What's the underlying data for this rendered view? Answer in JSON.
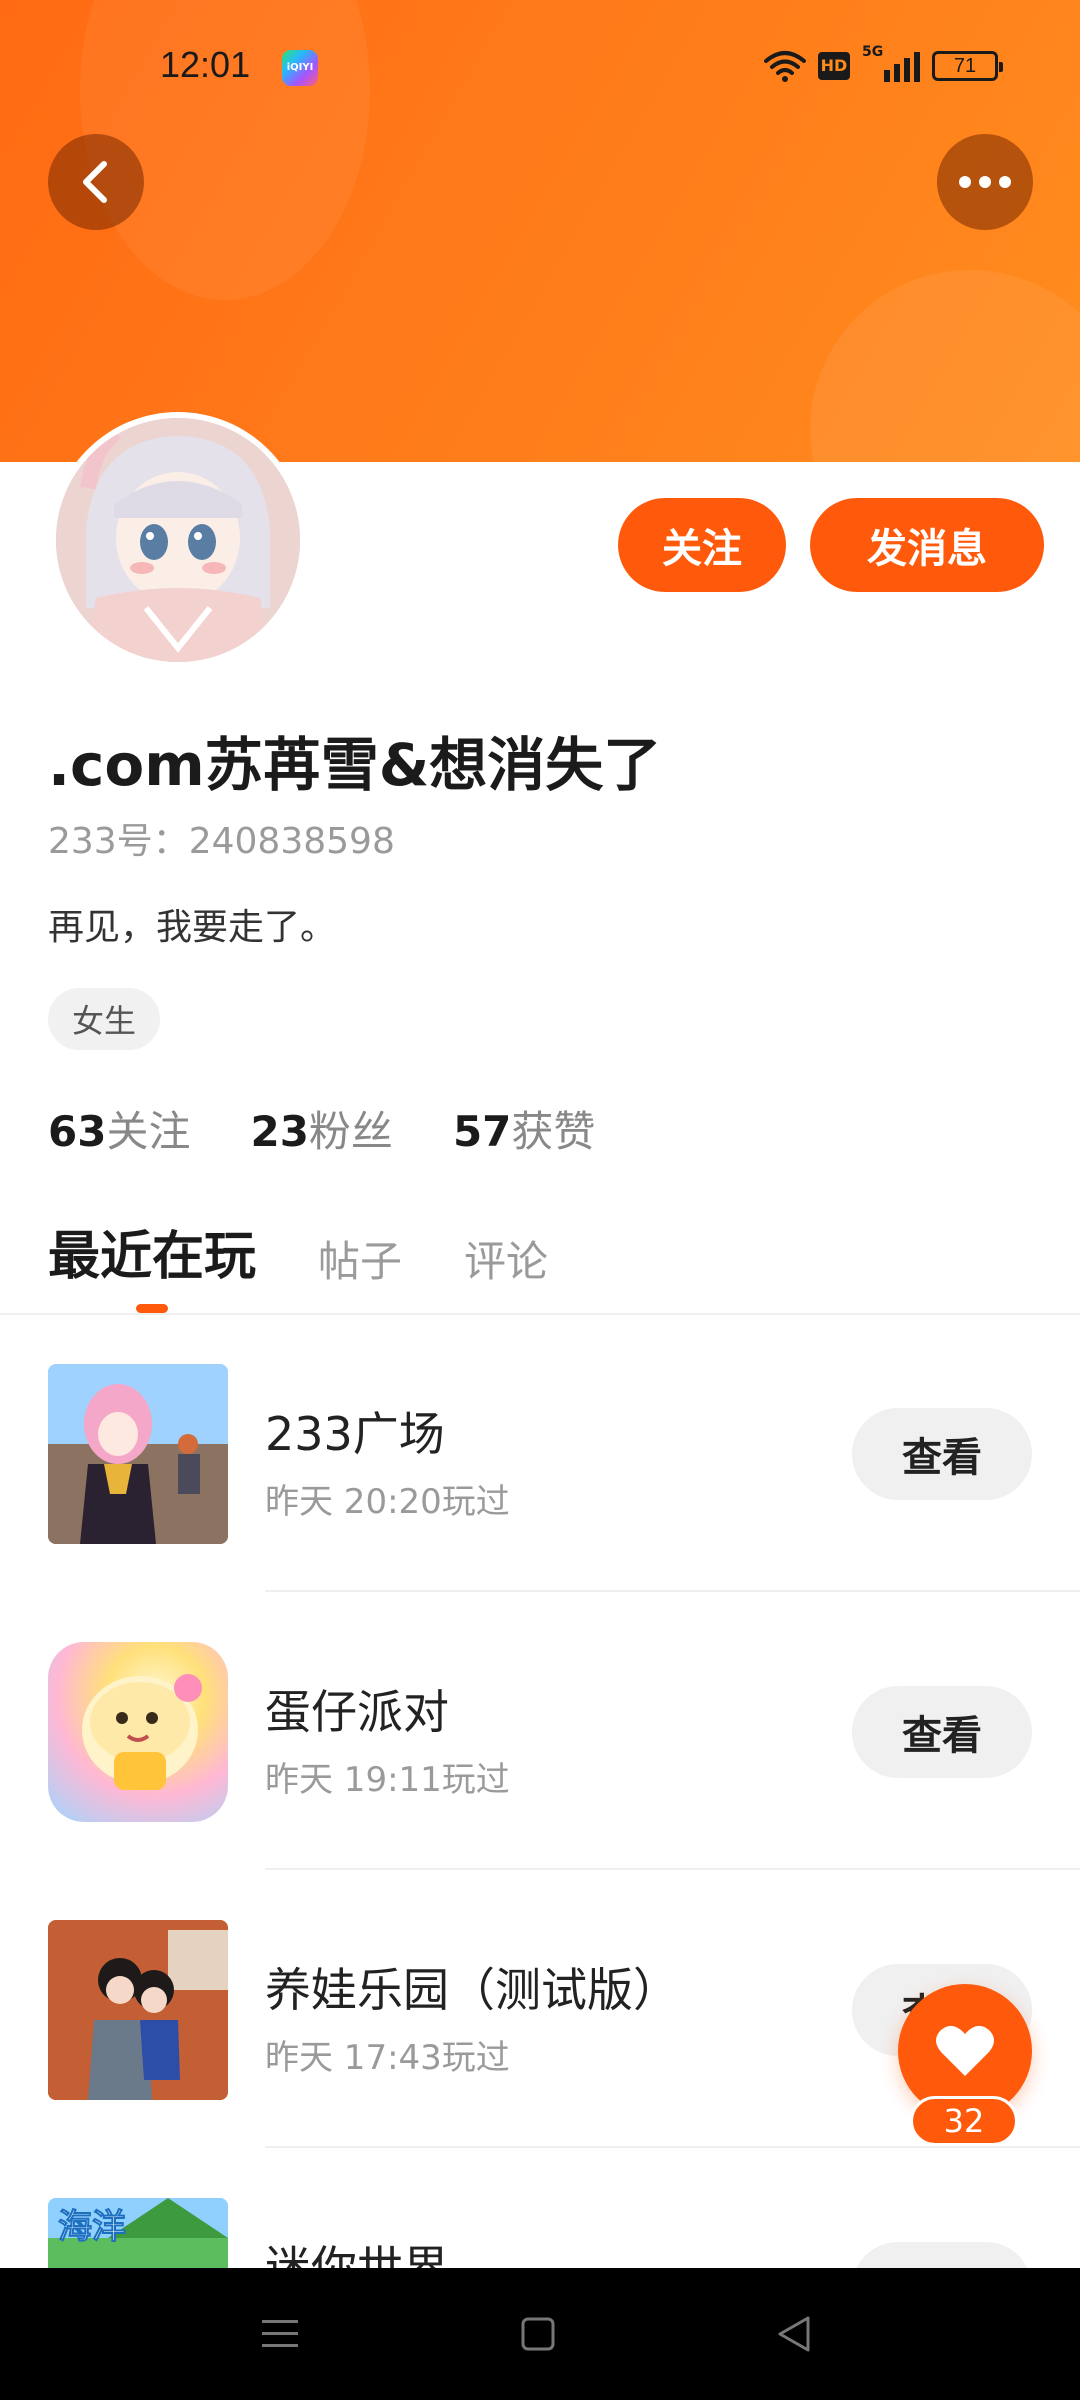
{
  "status_bar": {
    "time": "12:01",
    "app_icon_label": "iQIYI",
    "hd": "HD",
    "network": "5G",
    "battery": "71"
  },
  "profile": {
    "username": ".com苏苒雪&想消失了",
    "id_line": "233号：240838598",
    "bio": "再见，我要走了。",
    "tag": "女生",
    "follow_label": "关注",
    "message_label": "发消息"
  },
  "stats": [
    {
      "num": "63",
      "label": "关注"
    },
    {
      "num": "23",
      "label": "粉丝"
    },
    {
      "num": "57",
      "label": "获赞"
    }
  ],
  "tabs": [
    "最近在玩",
    "帖子",
    "评论"
  ],
  "games": [
    {
      "name": "233广场",
      "time": "昨天 20:20玩过",
      "button": "查看"
    },
    {
      "name": "蛋仔派对",
      "time": "昨天 19:11玩过",
      "button": "查看"
    },
    {
      "name": "养娃乐园（测试版）",
      "time": "昨天 17:43玩过",
      "button": "查看"
    },
    {
      "name": "迷你世界",
      "time": "",
      "button": ""
    }
  ],
  "like_count": "32",
  "colors": {
    "accent": "#ff5a0c",
    "banner": "#ff7a1a"
  },
  "icons": [
    "back-arrow-icon",
    "more-dots-icon",
    "heart-icon",
    "menu-icon",
    "home-square-icon",
    "back-triangle-icon",
    "wifi-icon",
    "signal-icon",
    "battery-icon"
  ]
}
